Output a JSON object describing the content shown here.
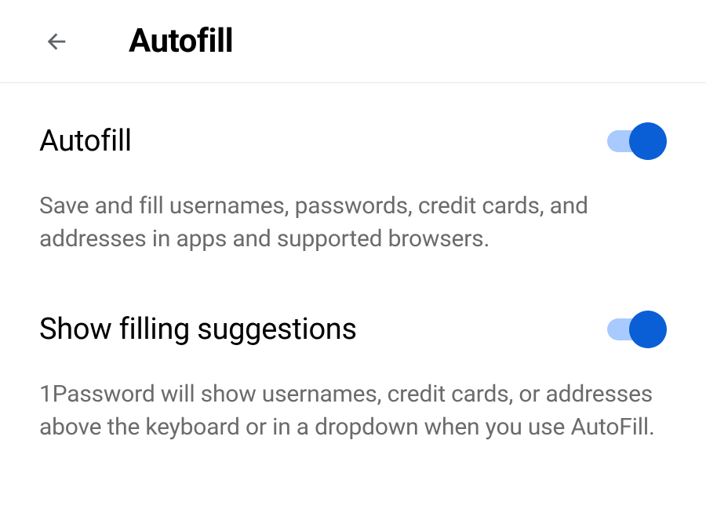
{
  "header": {
    "title": "Autofill"
  },
  "settings": {
    "autofill": {
      "title": "Autofill",
      "description": "Save and fill usernames, passwords, credit cards, and addresses in apps and supported browsers.",
      "enabled": true
    },
    "suggestions": {
      "title": "Show filling suggestions",
      "description": "1Password will show usernames, credit cards, or addresses above the keyboard or in a dropdown when you use AutoFill.",
      "enabled": true
    }
  }
}
